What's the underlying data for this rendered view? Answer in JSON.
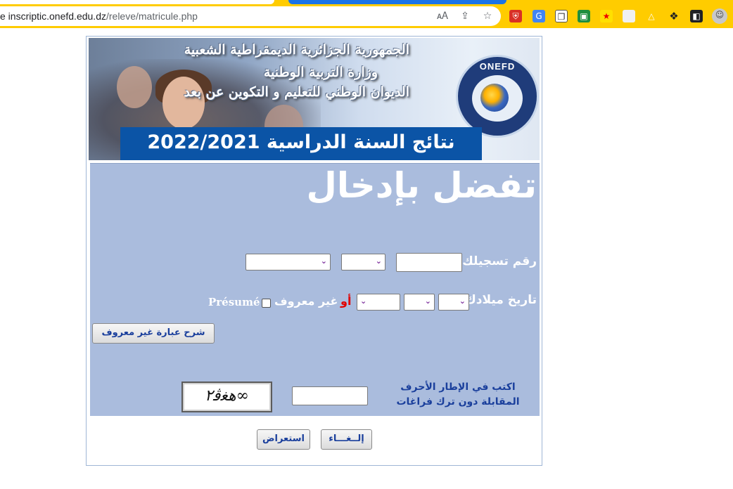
{
  "browser": {
    "url_host": "e  inscriptic.onefd.edu.dz",
    "url_path": "/releve/matricule.php",
    "omnibox_icons": [
      "translate-icon",
      "share-icon",
      "star-icon"
    ],
    "extension_icons": [
      "shield-icon",
      "google-translate-icon",
      "copy-icon",
      "extension-icon",
      "red-star-icon",
      "white-square-icon",
      "triangle-icon",
      "puzzle-icon",
      "sidepanel-icon",
      "profile-icon"
    ]
  },
  "banner": {
    "header_line1": "الجمهورية الجزائرية الديمقراطية الشعبية",
    "header_line2": "وزارة التربية الوطنية",
    "header_line3": "الديوان الوطني للتعليم و التكوين عن بعد",
    "logo_text": "ONEFD",
    "year_title": "نتائج السنة الدراسية  2022/2021"
  },
  "form": {
    "welcome": "تفضل بإدخال",
    "matricule_label": "رقم تسجيلك",
    "dob_label": "تاريخ ميلادك",
    "or_label": "أو",
    "unknown_label": "غير معروف",
    "presume_label": "Présumé",
    "explain_button": "شرح عبارة غير معروف",
    "captcha_label": "اكتب في الإطار الأحرف المقابلة دون ترك فراغات",
    "captcha_text": "ﮬﻐﭬ٢∞",
    "show_button": "استعراض",
    "cancel_button": "إلــغـــاء"
  }
}
